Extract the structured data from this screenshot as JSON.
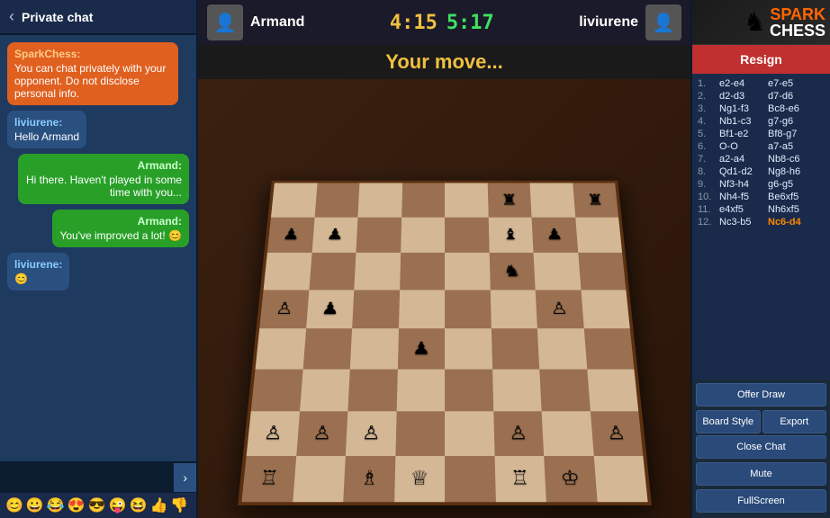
{
  "app": {
    "title": "SPARK CHESS",
    "logo_line1": "SPARK",
    "logo_line2": "CHESS"
  },
  "chat": {
    "title": "Private chat",
    "back_label": "‹",
    "send_label": "›",
    "input_placeholder": "",
    "messages": [
      {
        "sender": "SparkChess:",
        "sender_type": "system",
        "text": "You can chat privately with your opponent. Do not disclose personal info."
      },
      {
        "sender": "liviurene:",
        "sender_type": "opponent",
        "text": "Hello Armand"
      },
      {
        "sender": "Armand:",
        "sender_type": "me",
        "text": "Hi there. Haven't played in some time with you..."
      },
      {
        "sender": "Armand:",
        "sender_type": "me",
        "text": "You've improved a lot! 😊"
      },
      {
        "sender": "liviurene:",
        "sender_type": "opponent",
        "text": "😊"
      }
    ],
    "emojis": [
      "😊",
      "😀",
      "😂",
      "😍",
      "😎",
      "😜",
      "😆",
      "👍",
      "👎"
    ]
  },
  "board": {
    "white_player": "Armand",
    "black_player": "liviurene",
    "timer_white": "4:15",
    "timer_black": "5:17",
    "status_message": "Your move...",
    "resign_label": "Resign",
    "offer_draw_label": "Offer Draw",
    "board_style_label": "Board Style",
    "export_label": "Export",
    "close_chat_label": "Close Chat",
    "mute_label": "Mute",
    "fullscreen_label": "FullScreen"
  },
  "moves": [
    {
      "num": "1.",
      "white": "e2-e4",
      "black": "e7-e5"
    },
    {
      "num": "2.",
      "white": "d2-d3",
      "black": "d7-d6"
    },
    {
      "num": "3.",
      "white": "Ng1-f3",
      "black": "Bc8-e6"
    },
    {
      "num": "4.",
      "white": "Nb1-c3",
      "black": "g7-g6"
    },
    {
      "num": "5.",
      "white": "Bf1-e2",
      "black": "Bf8-g7"
    },
    {
      "num": "6.",
      "white": "O-O",
      "black": "a7-a5"
    },
    {
      "num": "7.",
      "white": "a2-a4",
      "black": "Nb8-c6"
    },
    {
      "num": "8.",
      "white": "Qd1-d2",
      "black": "Ng8-h6"
    },
    {
      "num": "9.",
      "white": "Nf3-h4",
      "black": "g6-g5"
    },
    {
      "num": "10.",
      "white": "Nh4-f5",
      "black": "Be6xf5"
    },
    {
      "num": "11.",
      "white": "e4xf5",
      "black": "Nh6xf5"
    },
    {
      "num": "12.",
      "white": "Nc3-b5",
      "black": "Nc6-d4",
      "highlight_black": true
    }
  ],
  "board_pieces": {
    "description": "Chess position after move 12",
    "cells": [
      [
        "",
        "",
        "",
        "",
        "",
        "♜",
        "",
        "♜"
      ],
      [
        "♟",
        "♟",
        "",
        "",
        "",
        "♝",
        "♟",
        ""
      ],
      [
        "",
        "",
        "",
        "",
        "",
        "♞",
        "",
        ""
      ],
      [
        "♙",
        "♟",
        "",
        "",
        "",
        "",
        "♙",
        ""
      ],
      [
        "",
        "",
        "",
        "♟",
        "",
        "",
        "",
        ""
      ],
      [
        "",
        "",
        "",
        "",
        "",
        "",
        "",
        ""
      ],
      [
        "♙",
        "♙",
        "♙",
        "",
        "",
        "♙",
        "",
        "♙"
      ],
      [
        "♖",
        "",
        "♗",
        "♕",
        "",
        "♖",
        "♔",
        ""
      ]
    ]
  }
}
